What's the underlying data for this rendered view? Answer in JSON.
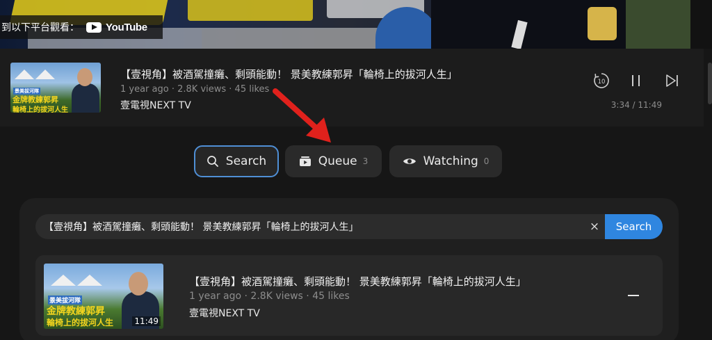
{
  "video_overlay": {
    "watch_on_label": "到以下平台觀看：",
    "youtube_label": "YouTube"
  },
  "now_playing": {
    "title": "【壹視角】被酒駕撞癱、剩頭能動！ 景美教練郭昇「輪椅上的拔河人生」",
    "meta": "1 year ago · 2.8K views · 45 likes",
    "channel": "壹電視NEXT TV",
    "time": "3:34 / 11:49",
    "controls": {
      "replay_icon": "replay-10-icon",
      "replay_label": "10",
      "pause_icon": "pause-icon",
      "next_icon": "skip-next-icon"
    },
    "thumbnail_caption_top": "景美拔河隊",
    "thumbnail_caption_mid": "金牌教練郭昇",
    "thumbnail_caption_bottom": "輪椅上的拔河人生"
  },
  "tabs": [
    {
      "label": "Search",
      "icon": "search-icon",
      "count": "",
      "active": true
    },
    {
      "label": "Queue",
      "icon": "queue-icon",
      "count": "3",
      "active": false
    },
    {
      "label": "Watching",
      "icon": "eye-icon",
      "count": "0",
      "active": false
    }
  ],
  "search": {
    "query": "【壹視角】被酒駕撞癱、剩頭能動！ 景美教練郭昇「輪椅上的拔河人生」",
    "clear_label": "×",
    "button_label": "Search"
  },
  "results": [
    {
      "title": "【壹視角】被酒駕撞癱、剩頭能動！ 景美教練郭昇「輪椅上的拔河人生」",
      "meta": "1 year ago · 2.8K views · 45 likes",
      "channel": "壹電視NEXT TV",
      "duration": "11:49",
      "thumbnail_caption_top": "景美拔河隊",
      "thumbnail_caption_mid": "金牌教練郭昇",
      "thumbnail_caption_bottom": "輪椅上的拔河人生"
    }
  ],
  "colors": {
    "accent": "#2f86e0",
    "active_tab_border": "#4f8fd6",
    "annotation_arrow": "#e0211c"
  }
}
